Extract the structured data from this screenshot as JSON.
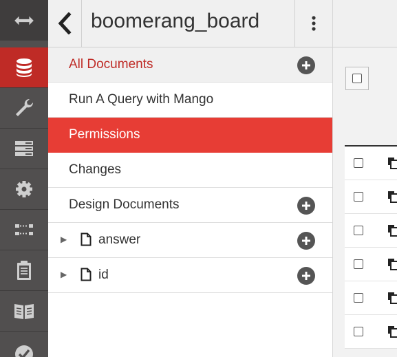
{
  "app": {
    "database_name": "boomerang_board"
  },
  "rail": {
    "items": [
      {
        "icon": "expand-arrows-icon"
      },
      {
        "icon": "database-icon",
        "active": true
      },
      {
        "icon": "wrench-icon"
      },
      {
        "icon": "server-icon"
      },
      {
        "icon": "gear-icon"
      },
      {
        "icon": "replication-icon"
      },
      {
        "icon": "clipboard-icon"
      },
      {
        "icon": "book-icon"
      },
      {
        "icon": "checkmark-icon"
      }
    ]
  },
  "nav": {
    "all_documents": "All Documents",
    "run_query": "Run A Query with Mango",
    "permissions": "Permissions",
    "changes": "Changes",
    "design_documents": "Design Documents",
    "design_docs": [
      {
        "name": "answer"
      },
      {
        "name": "id"
      }
    ]
  },
  "colors": {
    "accent": "#bf2b26",
    "selected": "#e73d35",
    "rail": "#514f4f"
  },
  "table": {
    "visible_rows": 6
  }
}
